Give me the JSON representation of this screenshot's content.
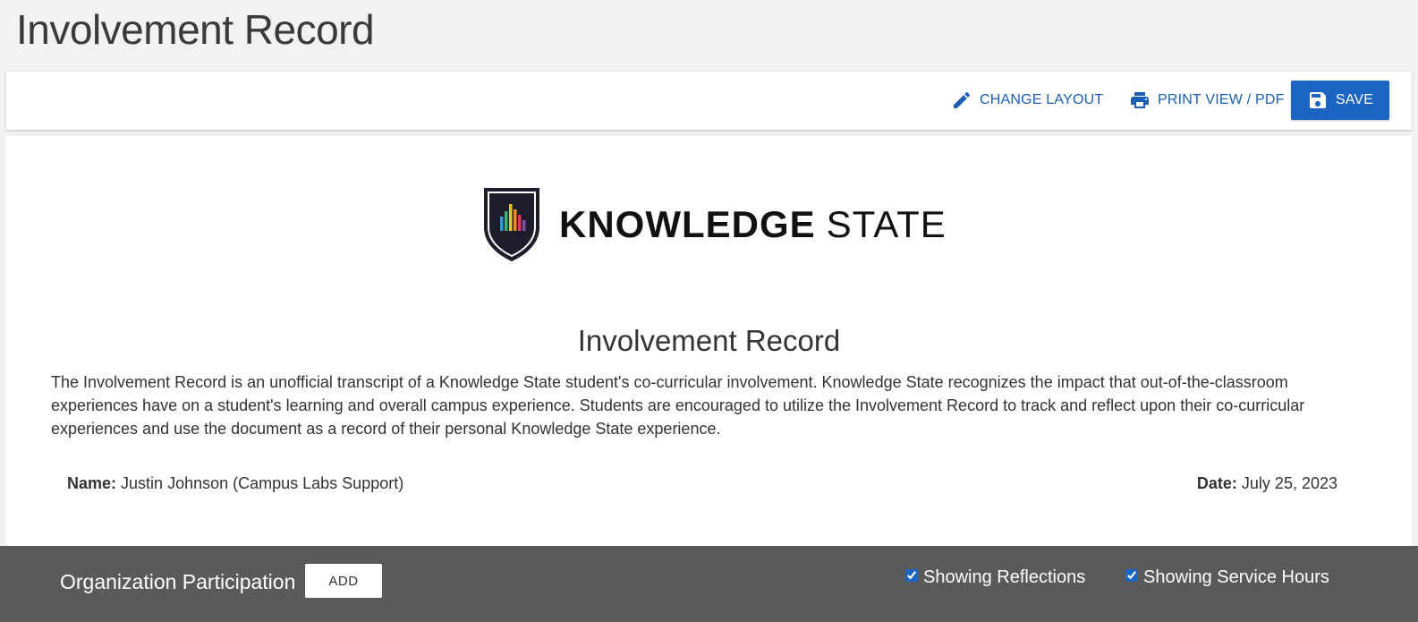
{
  "page": {
    "title": "Involvement Record"
  },
  "toolbar": {
    "change_layout_label": "CHANGE LAYOUT",
    "print_label": "PRINT VIEW / PDF",
    "save_label": "SAVE",
    "accent_color": "#1b5fb5"
  },
  "logo": {
    "bold_text": "KNOWLEDGE",
    "light_text": "STATE"
  },
  "document": {
    "title": "Involvement Record",
    "intro": "The Involvement Record is an unofficial transcript of a Knowledge State student's co-curricular involvement. Knowledge State recognizes the impact that out-of-the-classroom experiences have on a student's learning and overall campus experience. Students are encouraged to utilize the Involvement Record to track and reflect upon their co-curricular experiences and use the document as a record of their personal Knowledge State experience.",
    "name_label": "Name:",
    "name_value": "Justin Johnson (Campus Labs Support)",
    "date_label": "Date:",
    "date_value": "July 25, 2023"
  },
  "section": {
    "title": "Organization Participation",
    "add_label": "ADD",
    "show_reflections_label": "Showing Reflections",
    "show_reflections_checked": true,
    "show_hours_label": "Showing Service Hours",
    "show_hours_checked": true,
    "bar_color": "#5a5a5a"
  }
}
